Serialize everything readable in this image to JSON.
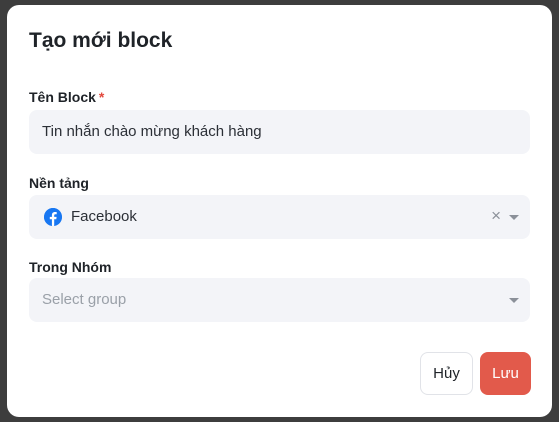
{
  "modal": {
    "title": "Tạo mới block",
    "fields": {
      "name": {
        "label": "Tên Block",
        "required_mark": "*",
        "value": "Tin nhắn chào mừng khách hàng"
      },
      "platform": {
        "label": "Nền tảng",
        "value": "Facebook",
        "icon": "facebook-icon",
        "clear_glyph": "×"
      },
      "group": {
        "label": "Trong Nhóm",
        "placeholder": "Select group"
      }
    },
    "buttons": {
      "cancel": "Hủy",
      "save": "Lưu"
    }
  },
  "colors": {
    "accent": "#e25a4b",
    "required": "#e2483d",
    "field_bg": "#f3f4f8",
    "facebook": "#1877f2"
  }
}
